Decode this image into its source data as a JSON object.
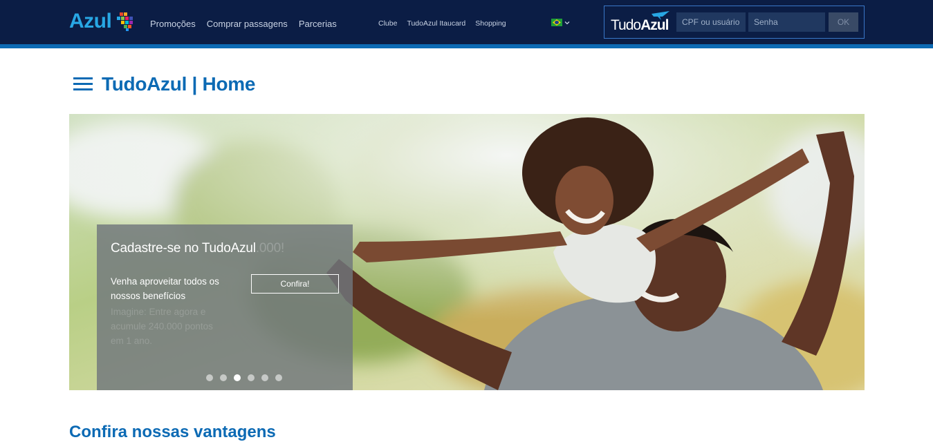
{
  "header": {
    "logo_text": "Azul",
    "main_nav": [
      "Promoções",
      "Comprar passagens",
      "Parcerias"
    ],
    "sub_nav": [
      "Clube",
      "TudoAzul Itaucard",
      "Shopping"
    ],
    "language_flag": "brazil-flag-icon",
    "login": {
      "brand_light": "Tudo",
      "brand_bold": "Azul",
      "user_placeholder": "CPF ou usuário",
      "password_placeholder": "Senha",
      "submit_label": "OK"
    }
  },
  "page": {
    "title_light": "Tudo",
    "title_bold": "Azul",
    "title_separator": " | ",
    "title_section": "Home"
  },
  "hero": {
    "promo_title": "Cadastre-se no TudoAzul",
    "promo_title_ghost": ".000!",
    "promo_description": "Venha aproveitar todos os nossos benefícios",
    "promo_ghost_text": "Imagine: Entre agora e acumule 240.000 pontos em 1 ano.",
    "cta_label": "Confira!",
    "slides_total": 6,
    "active_slide": 3
  },
  "section": {
    "title": "Confira nossas vantagens"
  },
  "colors": {
    "header_bg": "#0b1d45",
    "accent_blue": "#0c6ab4",
    "logo_blue": "#28a7e4"
  }
}
